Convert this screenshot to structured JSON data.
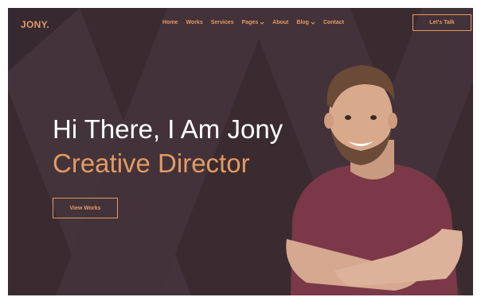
{
  "brand": {
    "logo": "JONY."
  },
  "nav": {
    "items": [
      {
        "label": "Home"
      },
      {
        "label": "Works"
      },
      {
        "label": "Services"
      },
      {
        "label": "Pages"
      },
      {
        "label": "About"
      },
      {
        "label": "Blog"
      },
      {
        "label": "Contact"
      }
    ]
  },
  "header": {
    "cta_label": "Let's Talk"
  },
  "hero": {
    "headline": "Hi There, I Am Jony",
    "subline": "Creative Director",
    "button_label": "View Works"
  },
  "colors": {
    "accent": "#e39a63",
    "background": "#3a2b30",
    "text": "#ffffff",
    "shirt": "#7a3848"
  },
  "icons": {
    "dropdown": "chevron-down-icon"
  }
}
